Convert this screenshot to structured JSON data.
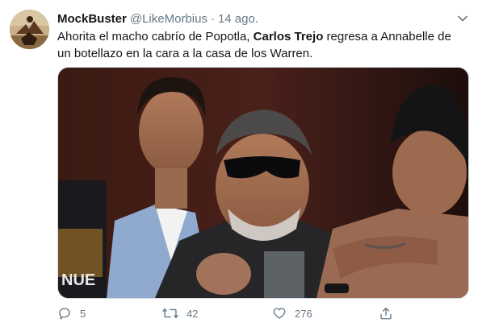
{
  "tweet": {
    "author_name": "MockBuster",
    "author_handle": "@LikeMorbius",
    "separator": "·",
    "date": "14 ago.",
    "text_before": "Ahorita el macho cabrío de Popotla, ",
    "text_bold": "Carlos Trejo",
    "text_after": " regresa a Annabelle de un botellazo en la cara a la casa de los Warren.",
    "media_logo": "NUE"
  },
  "actions": {
    "reply_count": "5",
    "retweet_count": "42",
    "like_count": "276"
  },
  "icons": {
    "reply": "reply-icon",
    "retweet": "retweet-icon",
    "like": "heart-icon",
    "share": "share-icon",
    "caret": "chevron-down-icon"
  },
  "colors": {
    "text": "#14171a",
    "secondary": "#657786",
    "background": "#ffffff"
  }
}
